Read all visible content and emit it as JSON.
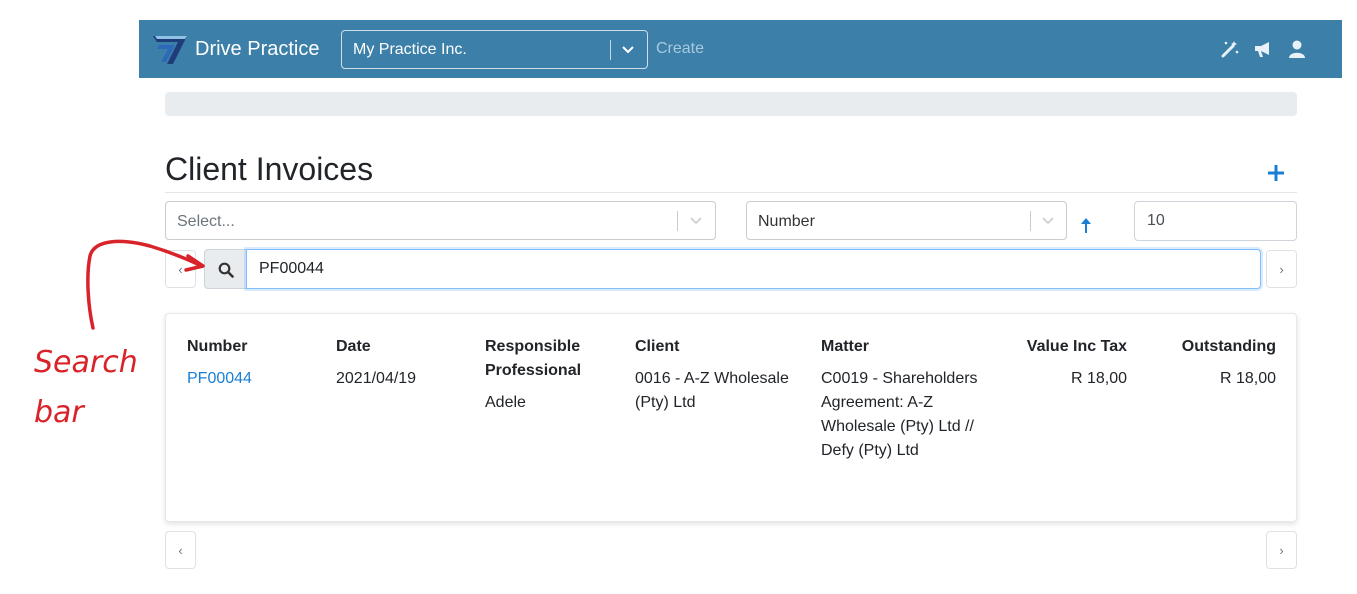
{
  "header": {
    "brand": "Drive Practice",
    "practice": "My Practice Inc.",
    "create": "Create"
  },
  "page": {
    "title": "Client Invoices"
  },
  "filters": {
    "client_placeholder": "Select...",
    "sort_field": "Number",
    "page_size": "10"
  },
  "search": {
    "value": "PF00044"
  },
  "pager": {
    "prev": "‹",
    "next": "›"
  },
  "annotation": {
    "line1": "Search",
    "line2": "bar"
  },
  "table": {
    "headers": {
      "number": "Number",
      "date": "Date",
      "professional": "Responsible Professional",
      "client": "Client",
      "matter": "Matter",
      "value": "Value Inc Tax",
      "outstanding": "Outstanding"
    },
    "rows": [
      {
        "number": "PF00044",
        "date": "2021/04/19",
        "professional": "Adele",
        "client": "0016 - A-Z Wholesale (Pty) Ltd",
        "matter": "C0019 - Shareholders Agreement: A-Z Wholesale (Pty) Ltd // Defy (Pty) Ltd",
        "value": "R 18,00",
        "outstanding": "R 18,00"
      }
    ]
  },
  "colors": {
    "navbar": "#3c7fa8",
    "link": "#1a7fd4",
    "annotation": "#d9232a"
  }
}
